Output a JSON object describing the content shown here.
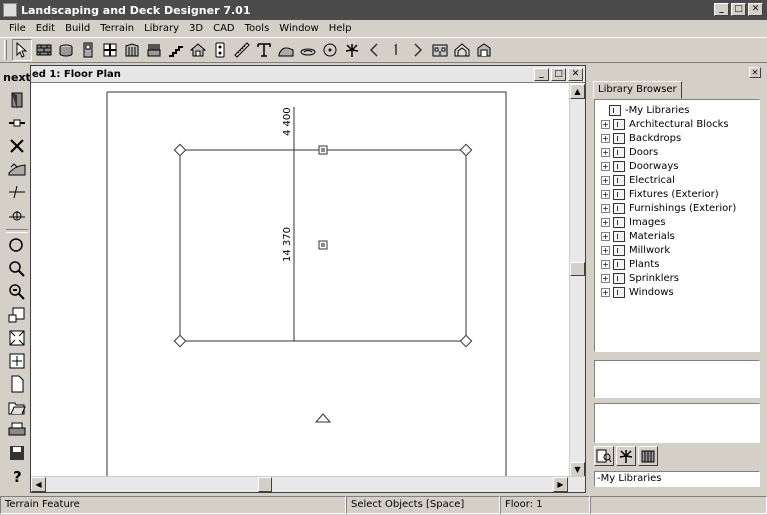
{
  "window": {
    "title": "Landscaping and Deck Designer 7.01",
    "min_label": "_",
    "max_label": "□",
    "close_label": "✕"
  },
  "menu": {
    "items": [
      {
        "label": "File"
      },
      {
        "label": "Edit"
      },
      {
        "label": "Build"
      },
      {
        "label": "Terrain"
      },
      {
        "label": "Library"
      },
      {
        "label": "3D"
      },
      {
        "label": "CAD"
      },
      {
        "label": "Tools"
      },
      {
        "label": "Window"
      },
      {
        "label": "Help"
      }
    ]
  },
  "toolbar": {
    "icons": [
      "select-arrow-icon",
      "wall-icon",
      "terrain-icon",
      "door-icon",
      "window-icon",
      "cabinet-icon",
      "furniture-icon",
      "stairs-icon",
      "house-icon",
      "electrical-icon",
      "dimension-icon",
      "text-icon",
      "terrain-feature-icon",
      "terrain-path-icon",
      "sprinkler-icon",
      "plant-icon",
      "back-icon",
      "floor-icon",
      "forward-icon",
      "elevation-icon",
      "perspective-icon",
      "camera-icon"
    ]
  },
  "left_toolbar": {
    "next_label": "next"
  },
  "document": {
    "title": "ed 1: Floor Plan",
    "dimension_top": "4 400",
    "dimension_side": "14 370"
  },
  "library": {
    "tab_label": "Library Browser",
    "root": "-My Libraries",
    "items": [
      "Architectural Blocks",
      "Backdrops",
      "Doors",
      "Doorways",
      "Electrical",
      "Fixtures (Exterior)",
      "Furnishings (Exterior)",
      "Images",
      "Materials",
      "Millwork",
      "Plants",
      "Sprinklers",
      "Windows"
    ],
    "path": "-My Libraries"
  },
  "status": {
    "left": "Terrain Feature",
    "middle": "Select Objects [Space]",
    "floor": "Floor: 1"
  }
}
